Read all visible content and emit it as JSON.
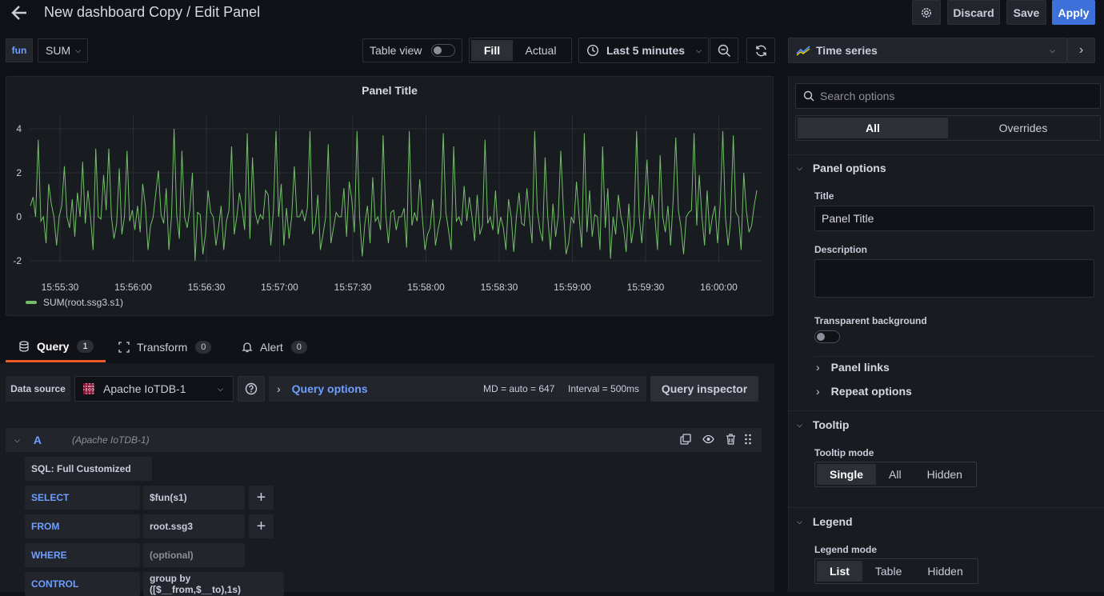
{
  "header": {
    "title": "New dashboard Copy / Edit Panel",
    "discard_label": "Discard",
    "save_label": "Save",
    "apply_label": "Apply"
  },
  "toolbar": {
    "var_name": "fun",
    "var_value": "SUM",
    "table_view_label": "Table view",
    "table_view_on": false,
    "fill_label": "Fill",
    "actual_label": "Actual",
    "time_range": "Last 5 minutes",
    "visualization": "Time series"
  },
  "panel": {
    "title": "Panel Title",
    "legend_label": "SUM(root.ssg3.s1)",
    "series_color": "#73bf69"
  },
  "chart_data": {
    "type": "line",
    "title": "Panel Title",
    "x_tick_labels": [
      "15:55:30",
      "15:56:00",
      "15:56:30",
      "15:57:00",
      "15:57:30",
      "15:58:00",
      "15:58:30",
      "15:59:00",
      "15:59:30",
      "16:00:00"
    ],
    "y_tick_labels": [
      "4",
      "2",
      "0",
      "-2"
    ],
    "ylim": [
      -2.5,
      4.5
    ],
    "grid": true,
    "legend_position": "bottom-left",
    "series": [
      {
        "name": "SUM(root.ssg3.s1)",
        "values": [
          0.5,
          0.9,
          0,
          3.5,
          -0.2,
          0,
          -1.2,
          1.5,
          0.6,
          0,
          -1.3,
          0,
          0.5,
          2.3,
          0,
          -0.5,
          0.8,
          -0.9,
          1.1,
          0,
          2.5,
          -0.3,
          1.2,
          0,
          -1.5,
          3.1,
          0,
          -0.1,
          1.9,
          0.3,
          3.1,
          0,
          -1,
          -0.3,
          2.2,
          -0.8,
          0,
          3,
          -0.2,
          0.3,
          -0.6,
          0.5,
          -0.7,
          1.5,
          0.5,
          -1.5,
          -0.4,
          0,
          1.1,
          2.1,
          0.1,
          -0.3,
          1.3,
          -1.5,
          0,
          4,
          0.1,
          -1,
          3,
          0,
          -0.5,
          0.3,
          2,
          -2,
          0.2,
          0.1,
          -1.7,
          -0.8,
          1.2,
          0.2,
          0,
          -1.3,
          -0.5,
          0.5,
          -1.5,
          -0.2,
          0.3,
          3.2,
          -0.8,
          0,
          1.1,
          0.4,
          -0.6,
          3.8,
          -1,
          2.7,
          0.2,
          -0.3,
          0.1,
          -0.1,
          1.2,
          1,
          -1.3,
          0.3,
          3.9,
          0,
          1.5,
          -1.3,
          0.4,
          -1,
          0,
          2.3,
          0,
          0,
          0.3,
          -0.2,
          0.4,
          3.9,
          -0.8,
          -0.4,
          1,
          -1.5,
          -0.8,
          0,
          3.3,
          -1.2,
          -0.5,
          0.2,
          0,
          0,
          1.3,
          -0.9,
          1.6,
          0.8,
          -0.7,
          3.9,
          0,
          -1.8,
          -0.3,
          0.5,
          -1.2,
          1.8,
          -0.2,
          0,
          -0.6,
          3.7,
          0.1,
          -1.2,
          0.2,
          0.3,
          -0.6,
          0,
          0,
          0.4,
          -1.4,
          3.9,
          -0.4,
          0.2,
          -0.2,
          1.7,
          0,
          -1.5,
          -0.8,
          -0.5,
          0.8,
          -1.3,
          -0.6,
          0,
          3.8,
          0.2,
          -0.6,
          -1.5,
          3.2,
          -0.2,
          0,
          -0.4,
          1.4,
          -0.2,
          0.9,
          0,
          -1.1,
          1,
          -0.8,
          -0.4,
          3.5,
          -0.3,
          0,
          -0.6,
          1.2,
          -0.8,
          0,
          -0.5,
          -1.5,
          0.8,
          0,
          -1.6,
          0,
          1.1,
          -0.3,
          -0.4,
          1.3,
          0,
          -1.2,
          3.9,
          0.3,
          -0.6,
          -1.1,
          2.7,
          0,
          -1.5,
          0.6,
          -0.9,
          0,
          3,
          0.3,
          -1.7,
          -1.2,
          0,
          -0.3,
          1.6,
          0,
          -1.4,
          3.8,
          -0.7,
          1.2,
          -0.9,
          0.1,
          0,
          -1.5,
          3.2,
          -0.5,
          1.3,
          -1.9,
          0,
          -0.8,
          1,
          0,
          -0.5,
          -1.6,
          0.6,
          -1.2,
          -0.4,
          3.9,
          0,
          -1.2,
          0.6,
          2.6,
          -0.1,
          1,
          0,
          -1.5,
          2.8,
          0,
          -0.7,
          0.5,
          -1.3,
          0.8,
          3.6,
          0.3,
          -0.5,
          -1.7,
          0,
          0.2,
          0.3,
          3.8,
          -0.4,
          1.9,
          0,
          -1.3,
          1.2,
          -0.8,
          0,
          0.5,
          -1.2,
          0.6,
          3.9,
          0,
          -1.3,
          -0.2,
          3.7,
          0.2,
          0,
          -1.5,
          2,
          0.3,
          -0.7,
          -0.4,
          0.5,
          1.2
        ]
      }
    ]
  },
  "query_tabs": [
    {
      "label": "Query",
      "count": "1"
    },
    {
      "label": "Transform",
      "count": "0"
    },
    {
      "label": "Alert",
      "count": "0"
    }
  ],
  "query": {
    "data_source_label": "Data source",
    "data_source": "Apache IoTDB-1",
    "query_options_label": "Query options",
    "md": "MD = auto = 647",
    "interval": "Interval = 500ms",
    "inspector_label": "Query inspector",
    "ref_id": "A",
    "ref_source": "(Apache IoTDB-1)",
    "mode": "SQL: Full Customized",
    "select_kw": "SELECT",
    "select_val": "$fun(s1)",
    "from_kw": "FROM",
    "from_val": "root.ssg3",
    "where_kw": "WHERE",
    "where_placeholder": "(optional)",
    "control_kw": "CONTROL",
    "control_val": "group by ([$__from,$__to),1s)"
  },
  "options": {
    "search_placeholder": "Search options",
    "tab_all": "All",
    "tab_overrides": "Overrides",
    "panel_options_label": "Panel options",
    "title_label": "Title",
    "title_value": "Panel Title",
    "description_label": "Description",
    "transparent_label": "Transparent background",
    "panel_links_label": "Panel links",
    "repeat_options_label": "Repeat options",
    "tooltip_label": "Tooltip",
    "tooltip_mode_label": "Tooltip mode",
    "tooltip_modes": [
      "Single",
      "All",
      "Hidden"
    ],
    "legend_label": "Legend",
    "legend_mode_label": "Legend mode",
    "legend_modes": [
      "List",
      "Table",
      "Hidden"
    ]
  }
}
